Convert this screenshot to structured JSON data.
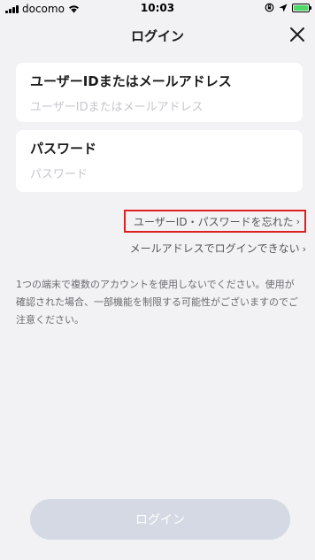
{
  "status_bar": {
    "carrier": "docomo",
    "time": "10:03",
    "icons": [
      "signal-icon",
      "wifi-icon",
      "orientation-lock-icon",
      "location-icon",
      "battery-charging-icon"
    ]
  },
  "header": {
    "title": "ログイン",
    "close_icon": "close-icon"
  },
  "form": {
    "user_id_label": "ユーザーIDまたはメールアドレス",
    "user_id_placeholder": "ユーザーIDまたはメールアドレス",
    "user_id_value": "",
    "password_label": "パスワード",
    "password_placeholder": "パスワード",
    "password_value": ""
  },
  "links": {
    "forgot": "ユーザーID・パスワードを忘れた",
    "cannot_login": "メールアドレスでログインできない"
  },
  "notice": "1つの端末で複数のアカウントを使用しないでください。使用が確認された場合、一部機能を制限する可能性がございますのでご注意ください。",
  "login_button": "ログイン",
  "colors": {
    "background": "#f2f2f5",
    "highlight_border": "#e02020",
    "login_button_disabled": "#d4d9e4",
    "battery": "#4cd964"
  }
}
